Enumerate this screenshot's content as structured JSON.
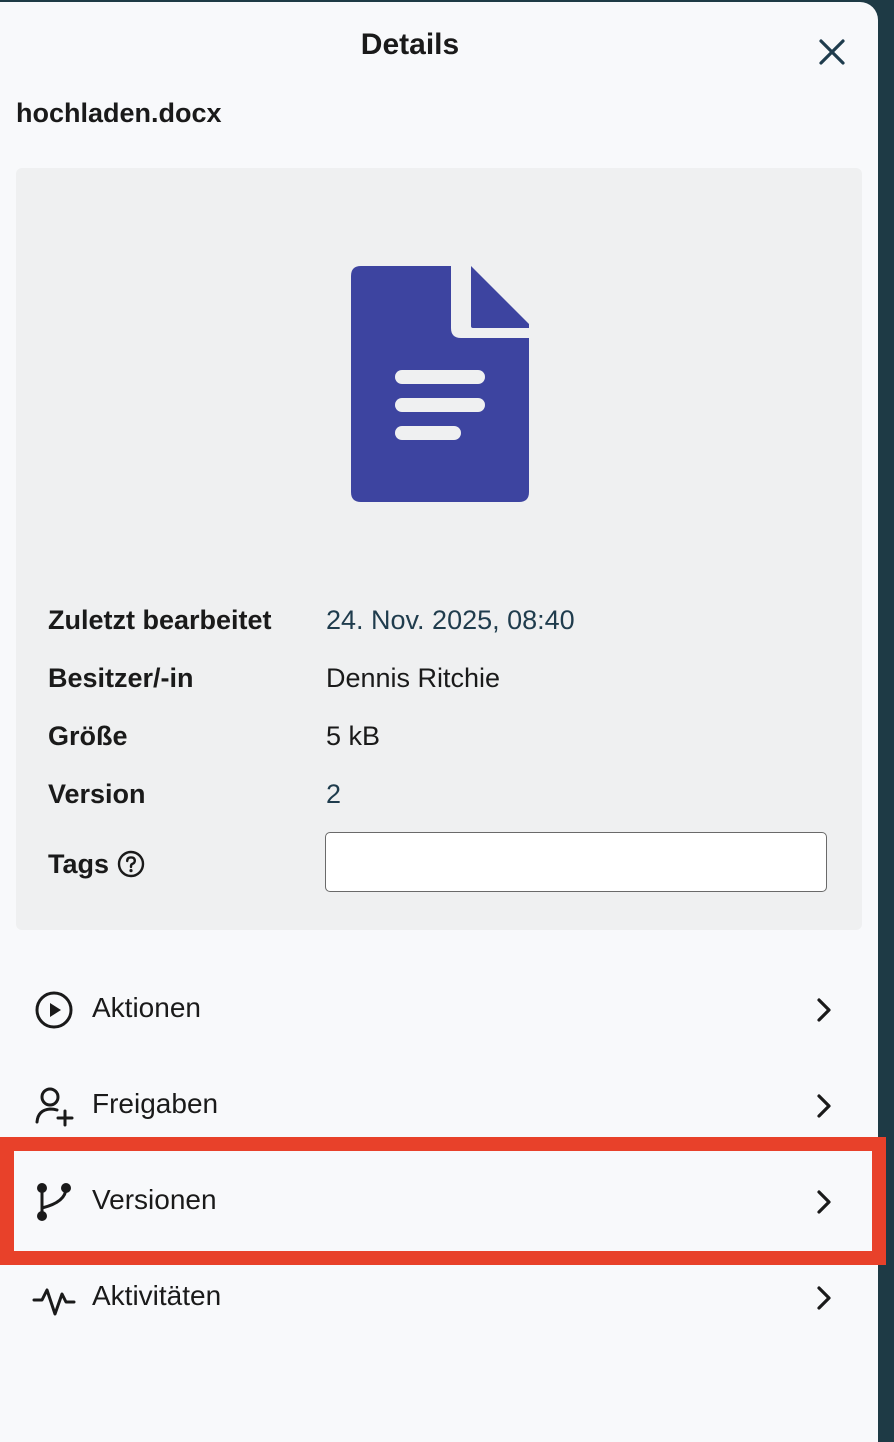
{
  "header": {
    "title": "Details"
  },
  "file": {
    "name": "hochladen.docx",
    "preview_icon": "document-icon",
    "icon_color": "#3d44a0"
  },
  "info": {
    "modified_label": "Zuletzt bearbeitet",
    "modified_value": "24. Nov. 2025, 08:40",
    "owner_label": "Besitzer/-in",
    "owner_value": "Dennis Ritchie",
    "size_label": "Größe",
    "size_value": "5 kB",
    "version_label": "Version",
    "version_value": "2",
    "tags_label": "Tags",
    "tags_value": ""
  },
  "nav": {
    "actions_label": "Aktionen",
    "shares_label": "Freigaben",
    "versions_label": "Versionen",
    "activities_label": "Aktivitäten"
  },
  "colors": {
    "highlight": "#e8412a",
    "panel_bg": "#f8f9fb",
    "card_bg": "#eff0f1",
    "backdrop": "#1e3a45"
  }
}
